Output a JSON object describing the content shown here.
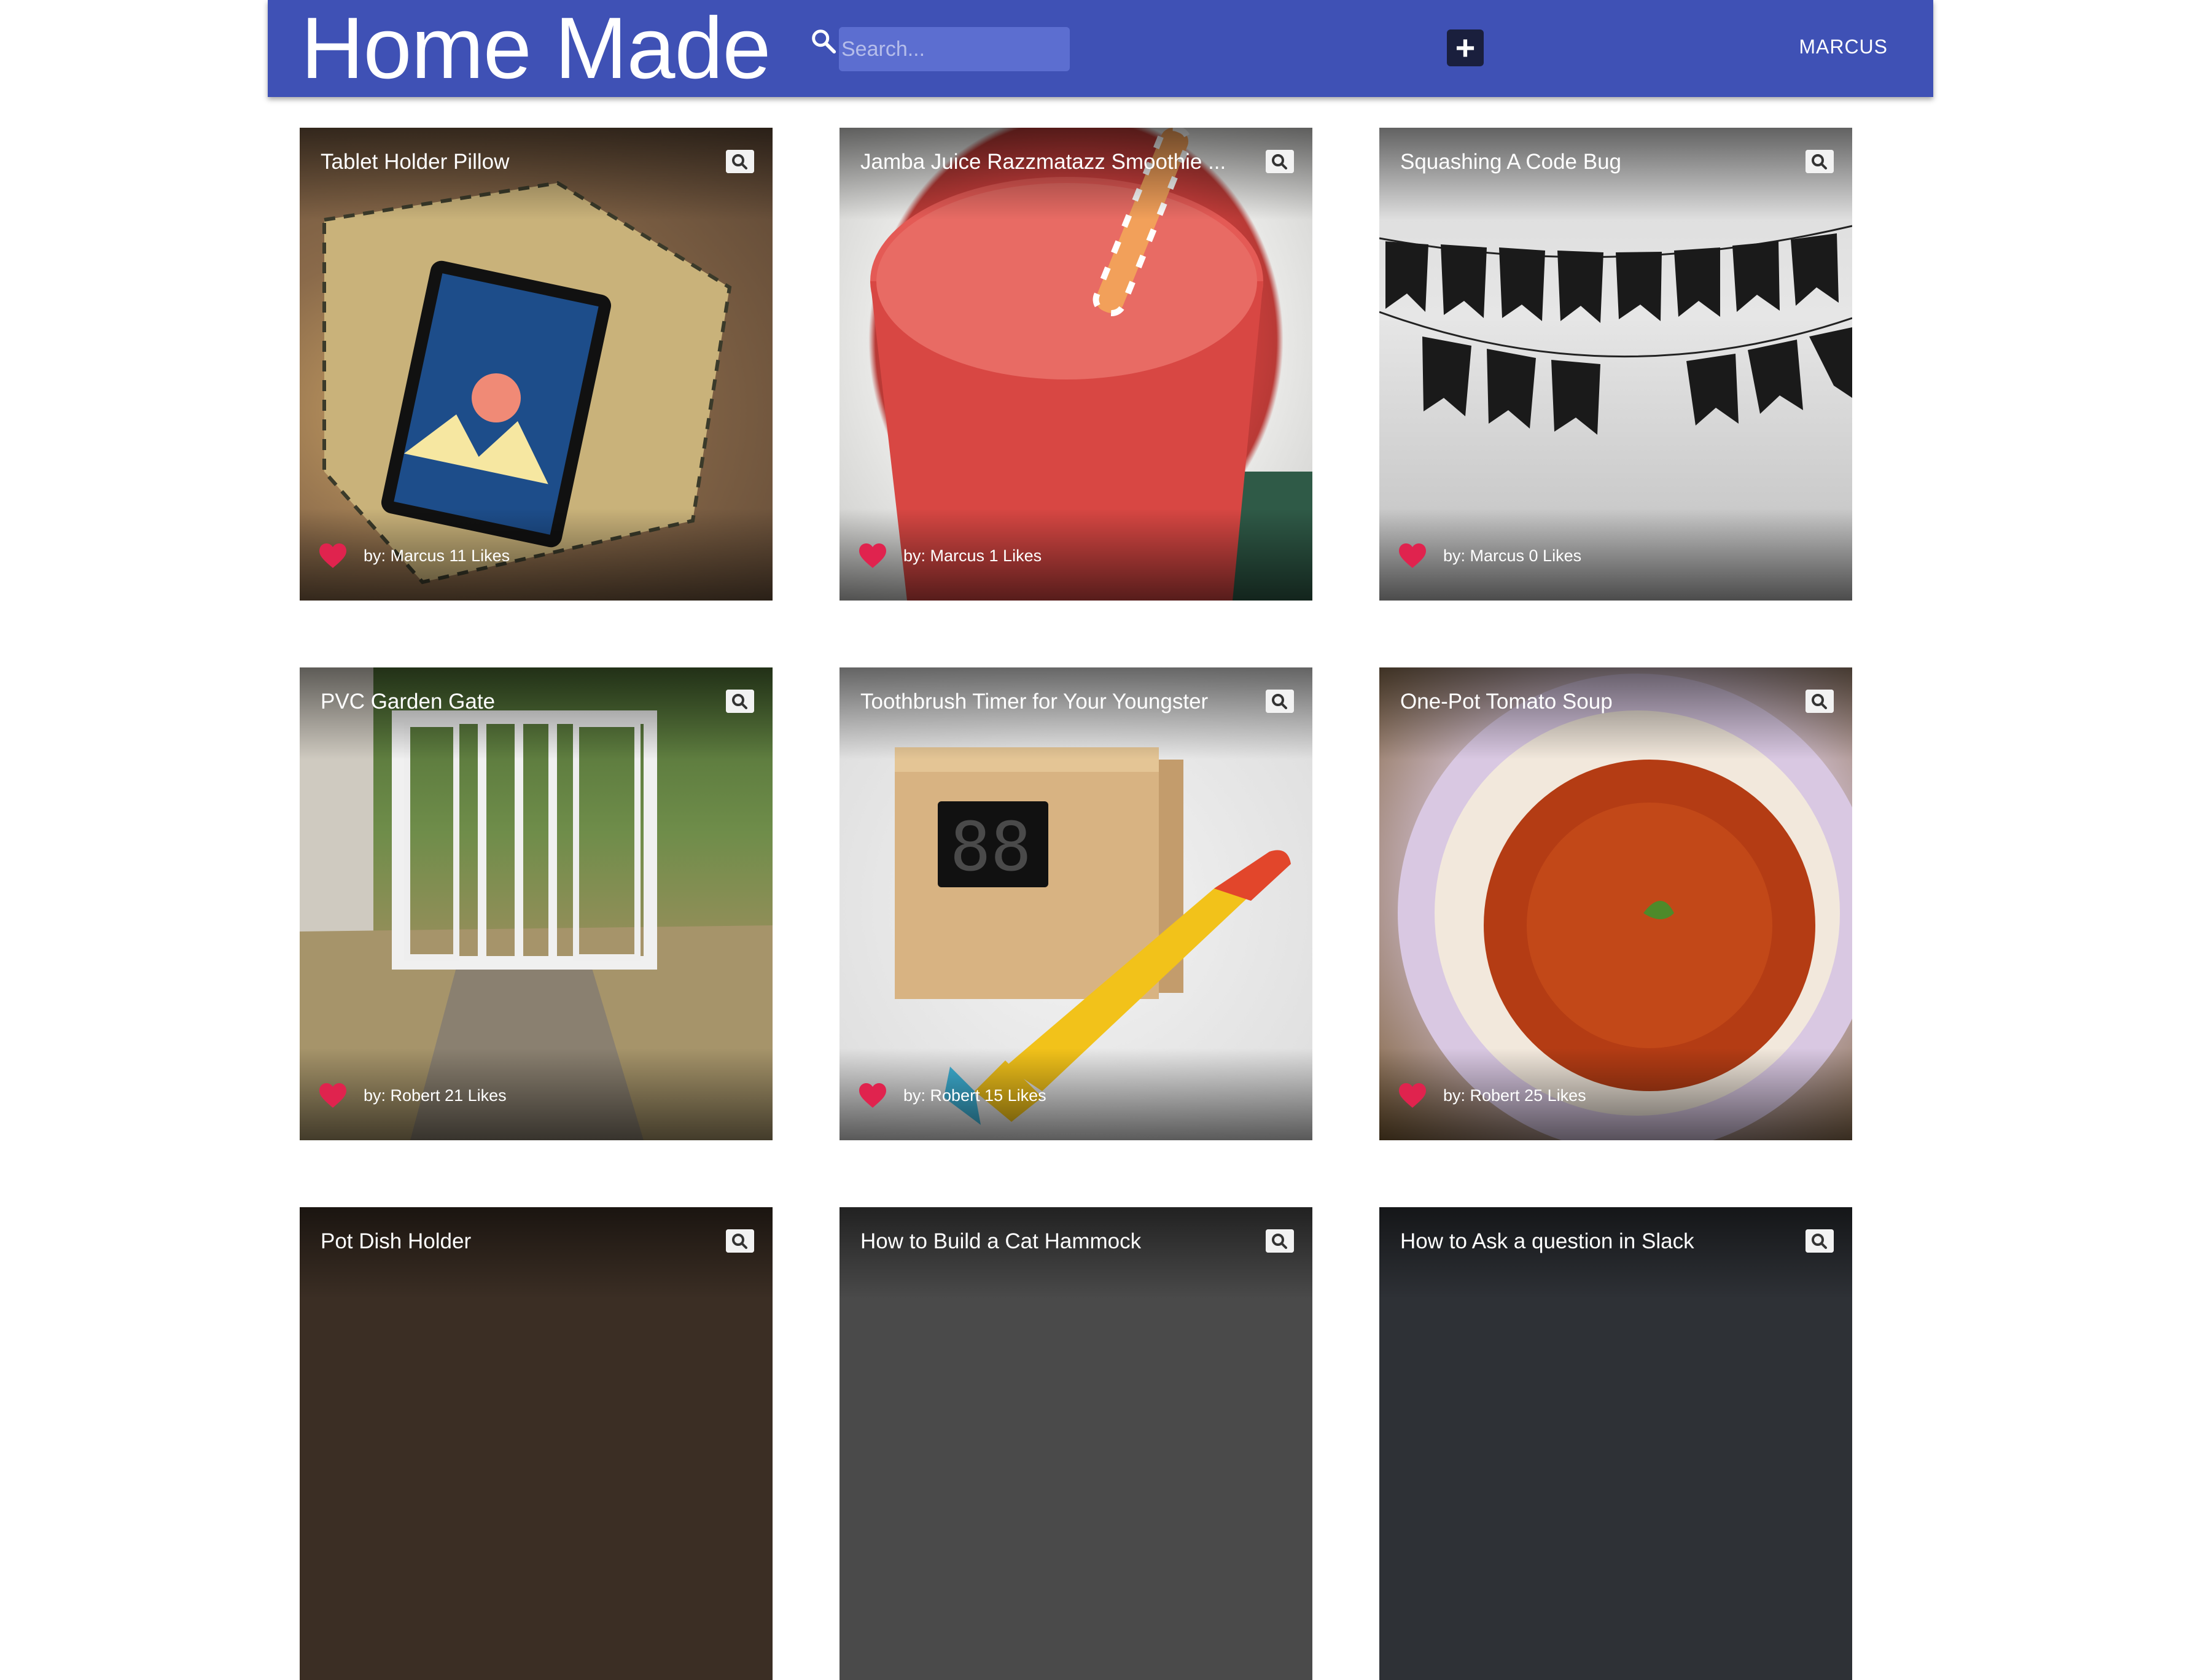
{
  "appbar": {
    "brand": "Home Made",
    "search_placeholder": "Search...",
    "add_label": "+",
    "user": "MARCUS"
  },
  "colors": {
    "appbar": "#3f51b5",
    "heart": "#e0234e"
  },
  "cards": [
    {
      "title": "Tablet Holder Pillow",
      "byline": "by: Marcus 11 Likes"
    },
    {
      "title": "Jamba Juice Razzmatazz Smoothie ...",
      "byline": "by: Marcus 1 Likes"
    },
    {
      "title": "Squashing A Code Bug",
      "byline": "by: Marcus 0 Likes"
    },
    {
      "title": "PVC Garden Gate",
      "byline": "by: Robert 21 Likes"
    },
    {
      "title": "Toothbrush Timer for Your Youngster",
      "byline": "by: Robert 15 Likes"
    },
    {
      "title": "One-Pot Tomato Soup",
      "byline": "by: Robert 25 Likes"
    },
    {
      "title": "Pot Dish Holder",
      "byline": ""
    },
    {
      "title": "How to Build a Cat Hammock",
      "byline": ""
    },
    {
      "title": "How to Ask a question in Slack",
      "byline": ""
    }
  ]
}
